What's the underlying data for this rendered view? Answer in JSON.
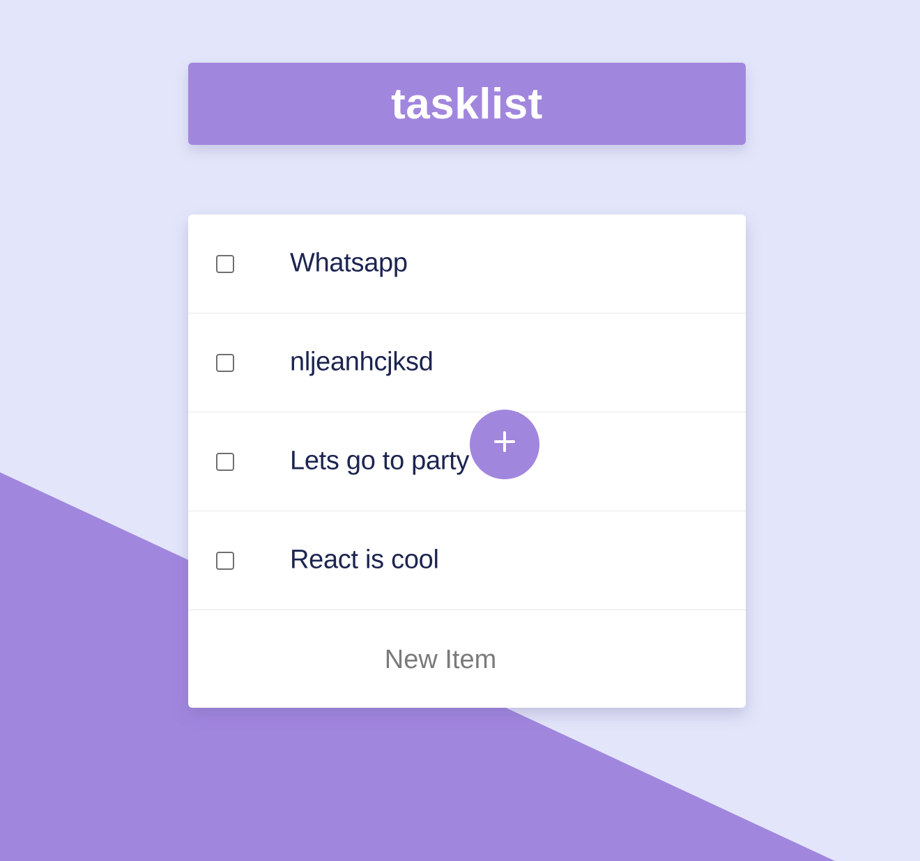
{
  "app": {
    "title": "tasklist"
  },
  "tasks": [
    {
      "label": "Whatsapp",
      "checked": false
    },
    {
      "label": "nljeanhcjksd",
      "checked": false
    },
    {
      "label": "Lets go to party",
      "checked": false
    },
    {
      "label": "React is cool",
      "checked": false
    }
  ],
  "new_item": {
    "placeholder": "New Item",
    "value": "",
    "add_icon": "plus-icon"
  },
  "colors": {
    "accent": "#a186de",
    "background": "#e3e6fa",
    "card": "#ffffff",
    "task_text": "#1c2450"
  }
}
